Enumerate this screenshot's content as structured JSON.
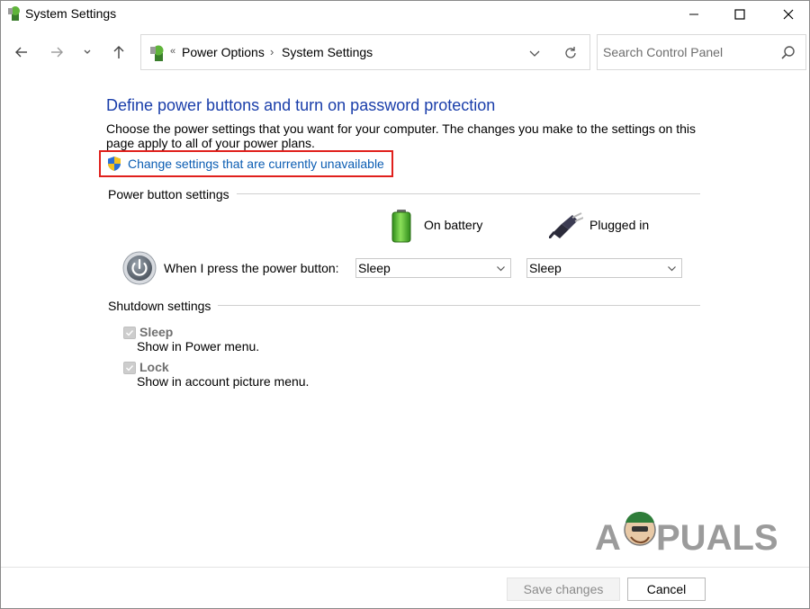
{
  "window": {
    "title": "System Settings"
  },
  "address_bar": {
    "separator_left": "«",
    "crumbs": [
      "Power Options",
      "System Settings"
    ],
    "crumb_separator": "›"
  },
  "search": {
    "placeholder": "Search Control Panel"
  },
  "content": {
    "title": "Define power buttons and turn on password protection",
    "description": "Choose the power settings that you want for your computer. The changes you make to the settings on this page apply to all of your power plans.",
    "change_link": "Change settings that are currently unavailable"
  },
  "power_button_settings": {
    "section_label": "Power button settings",
    "col_battery": "On battery",
    "col_plugged": "Plugged in",
    "row_label": "When I press the power button:",
    "battery_value": "Sleep",
    "plugged_value": "Sleep"
  },
  "shutdown_settings": {
    "section_label": "Shutdown settings",
    "items": [
      {
        "label": "Sleep",
        "description": "Show in Power menu.",
        "checked": true
      },
      {
        "label": "Lock",
        "description": "Show in account picture menu.",
        "checked": true
      }
    ]
  },
  "footer": {
    "save_label": "Save changes",
    "cancel_label": "Cancel"
  },
  "watermark": {
    "text": "APPUALS"
  },
  "colors": {
    "title_blue": "#1a3eaa",
    "link_blue": "#0b5db3",
    "highlight_red": "#e0201c"
  }
}
